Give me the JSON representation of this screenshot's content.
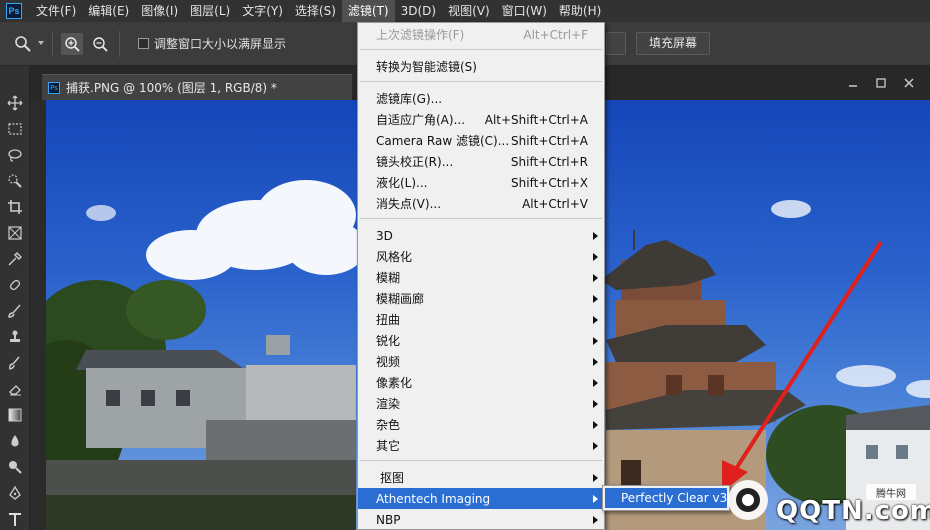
{
  "menubar": {
    "items": [
      "文件(F)",
      "编辑(E)",
      "图像(I)",
      "图层(L)",
      "文字(Y)",
      "选择(S)",
      "滤镜(T)",
      "3D(D)",
      "视图(V)",
      "窗口(W)",
      "帮助(H)"
    ],
    "active_index": 6
  },
  "options": {
    "resize_windows_label": "调整窗口大小以满屏显示",
    "fill_screen_label": "填充屏幕"
  },
  "document": {
    "tab_title": "捕获.PNG @ 100% (图层 1, RGB/8) *"
  },
  "filter_menu": {
    "last_filter": {
      "label": "上次滤镜操作(F)",
      "shortcut": "Alt+Ctrl+F"
    },
    "smart_filter": {
      "label": "转换为智能滤镜(S)"
    },
    "gallery": {
      "label": "滤镜库(G)..."
    },
    "adaptive_wide": {
      "label": "自适应广角(A)...",
      "shortcut": "Alt+Shift+Ctrl+A"
    },
    "camera_raw": {
      "label": "Camera Raw 滤镜(C)...",
      "shortcut": "Shift+Ctrl+A"
    },
    "lens_correction": {
      "label": "镜头校正(R)...",
      "shortcut": "Shift+Ctrl+R"
    },
    "liquify": {
      "label": "液化(L)...",
      "shortcut": "Shift+Ctrl+X"
    },
    "vanishing_point": {
      "label": "消失点(V)...",
      "shortcut": "Alt+Ctrl+V"
    },
    "submenus": [
      "3D",
      "风格化",
      "模糊",
      "模糊画廊",
      "扭曲",
      "锐化",
      "视频",
      "像素化",
      "渲染",
      "杂色",
      "其它"
    ],
    "cutout": {
      "label": "抠图"
    },
    "athentech": {
      "label": "Athentech Imaging"
    },
    "nbp": {
      "label": "NBP"
    }
  },
  "submenu": {
    "item": "Perfectly Clear v3"
  },
  "watermark": {
    "badge": "腾牛网",
    "site": "QQTN.com"
  },
  "colors": {
    "menu_highlight": "#2a6ed4",
    "arrow_red": "#e0201c"
  }
}
